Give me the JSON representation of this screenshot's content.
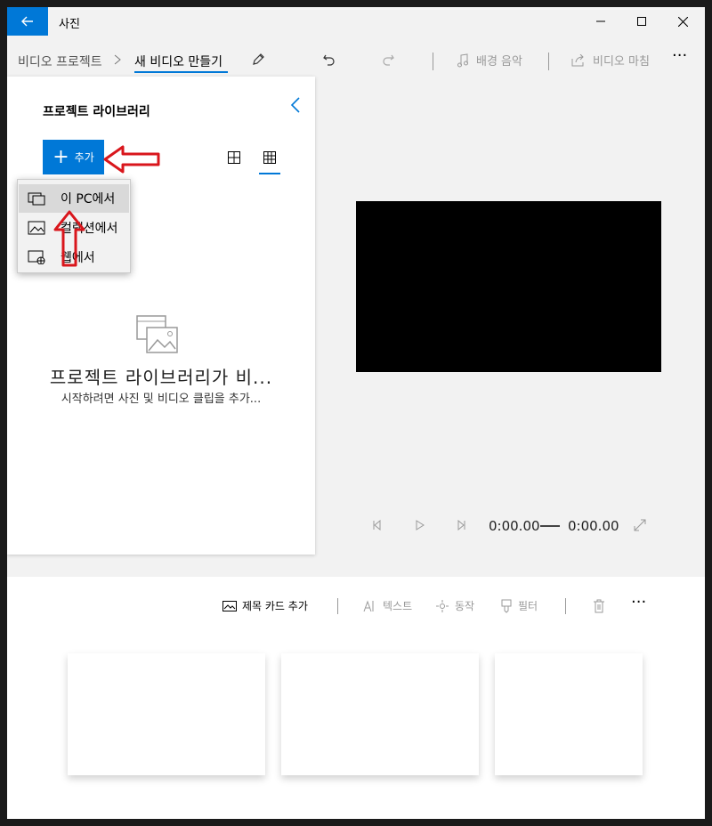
{
  "app": {
    "title": "사진"
  },
  "breadcrumb": {
    "parent": "비디오 프로젝트",
    "current": "새 비디오 만들기"
  },
  "toolbar": {
    "music": "배경 음악",
    "finish": "비디오 마침"
  },
  "library": {
    "title": "프로젝트 라이브러리",
    "add_label": "추가",
    "empty_title": "프로젝트 라이브러리가 비...",
    "empty_subtitle": "시작하려면 사진 및 비디오 클립을 추가..."
  },
  "add_menu": {
    "items": [
      {
        "label": "이 PC에서",
        "icon": "pc-icon"
      },
      {
        "label": "컬렉션에서",
        "icon": "collection-icon"
      },
      {
        "label": "웹에서",
        "icon": "web-icon"
      }
    ]
  },
  "player": {
    "current_time": "0:00.00",
    "total_time": "0:00.00"
  },
  "storyboard": {
    "title_card": "제목 카드 추가",
    "text": "텍스트",
    "motion": "동작",
    "filter": "필터"
  },
  "colors": {
    "accent": "#0078d7",
    "annotation": "#d9161c"
  }
}
